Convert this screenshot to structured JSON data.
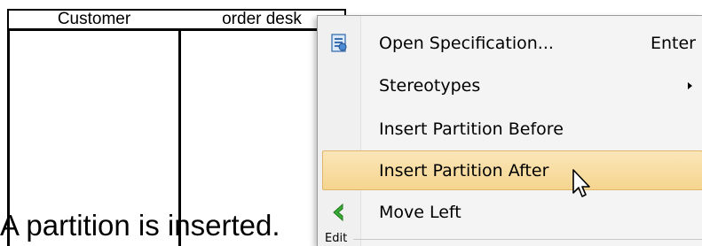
{
  "diagram": {
    "lanes": [
      {
        "label": "Customer"
      },
      {
        "label": "order desk"
      }
    ]
  },
  "caption": "A partition is inserted.",
  "context_menu": {
    "items": [
      {
        "label": "Open Specification...",
        "shortcut": "Enter",
        "icon": "specification-icon"
      },
      {
        "label": "Stereotypes",
        "has_submenu": true
      },
      {
        "label": "Insert Partition Before"
      },
      {
        "label": "Insert Partition After",
        "highlighted": true
      },
      {
        "label": "Move Left",
        "icon": "green-left-arrow-icon"
      }
    ],
    "next_section_label": "Edit"
  },
  "colors": {
    "highlight_top": "#fbe6b8",
    "highlight_bottom": "#f5d58f",
    "highlight_border": "#e0b46a",
    "menu_background": "#f4f4f4",
    "move_left_icon": "#3aa935"
  }
}
